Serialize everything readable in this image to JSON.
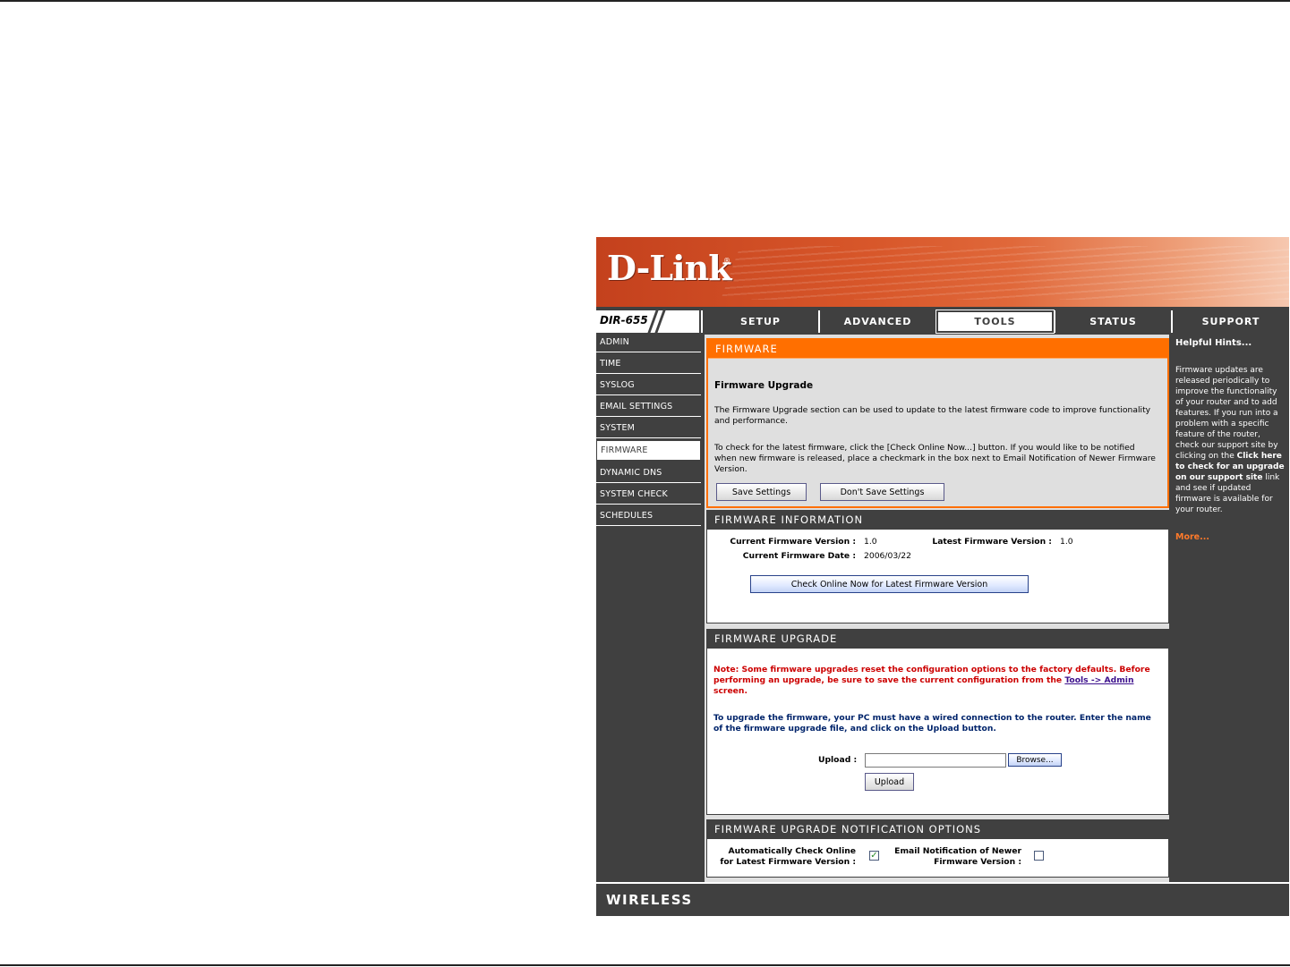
{
  "banner": {
    "logo": "D-Link",
    "logo_mark": "®"
  },
  "model": "DIR-655",
  "tabs": [
    {
      "label": "SETUP"
    },
    {
      "label": "ADVANCED"
    },
    {
      "label": "TOOLS"
    },
    {
      "label": "STATUS"
    },
    {
      "label": "SUPPORT"
    }
  ],
  "menu": [
    {
      "label": "ADMIN"
    },
    {
      "label": "TIME"
    },
    {
      "label": "SYSLOG"
    },
    {
      "label": "EMAIL SETTINGS"
    },
    {
      "label": "SYSTEM"
    },
    {
      "label": "FIRMWARE"
    },
    {
      "label": "DYNAMIC DNS"
    },
    {
      "label": "SYSTEM CHECK"
    },
    {
      "label": "SCHEDULES"
    }
  ],
  "firmware": {
    "heading": "FIRMWARE",
    "subtitle": "Firmware Upgrade",
    "para1": "The Firmware Upgrade section can be used to update to the latest firmware code to improve functionality and performance.",
    "para2": "To check for the latest firmware, click the [Check Online Now...] button. If you would like to be notified when new firmware is released, place a checkmark in the box next to Email Notification of Newer Firmware Version.",
    "save_label": "Save Settings",
    "dont_save_label": "Don't Save Settings"
  },
  "info": {
    "heading": "FIRMWARE INFORMATION",
    "current_version_label": "Current Firmware Version :",
    "current_version": "1.0",
    "latest_version_label": "Latest Firmware Version :",
    "latest_version": "1.0",
    "current_date_label": "Current Firmware Date :",
    "current_date": "2006/03/22",
    "check_button": "Check Online Now for Latest Firmware Version"
  },
  "upgrade": {
    "heading": "FIRMWARE UPGRADE",
    "note_part1": "Note: Some firmware upgrades reset the configuration options to the factory defaults. Before performing an upgrade, be sure to save the current configuration from the ",
    "note_link": "Tools -> Admin",
    "note_part2": " screen.",
    "instructions": "To upgrade the firmware, your PC must have a wired connection to the router. Enter the name of the firmware upgrade file, and click on the Upload button.",
    "upload_label": "Upload :",
    "upload_value": "",
    "browse_label": "Browse...",
    "upload_button": "Upload"
  },
  "notify": {
    "heading": "FIRMWARE UPGRADE NOTIFICATION OPTIONS",
    "auto_check_line1": "Automatically Check Online",
    "auto_check_line2": "for Latest Firmware Version :",
    "auto_check_checked": "✓",
    "email_line1": "Email Notification of Newer",
    "email_line2": "Firmware Version :"
  },
  "hints": {
    "title": "Helpful Hints...",
    "body_part1": "Firmware updates are released periodically to improve the functionality of your router and to add features. If you run into a problem with a specific feature of the router, check our support site by clicking on the ",
    "body_bold1": "Click here to check for an upgrade on our support site",
    "body_part2": " link and see if updated firmware is available for your router.",
    "more": "More..."
  },
  "footer": {
    "brand": "WIRELESS"
  },
  "colors": {
    "accent": "#ff6f00",
    "chrome": "#404040",
    "note": "#cc0000",
    "text_blue": "#00246b"
  }
}
